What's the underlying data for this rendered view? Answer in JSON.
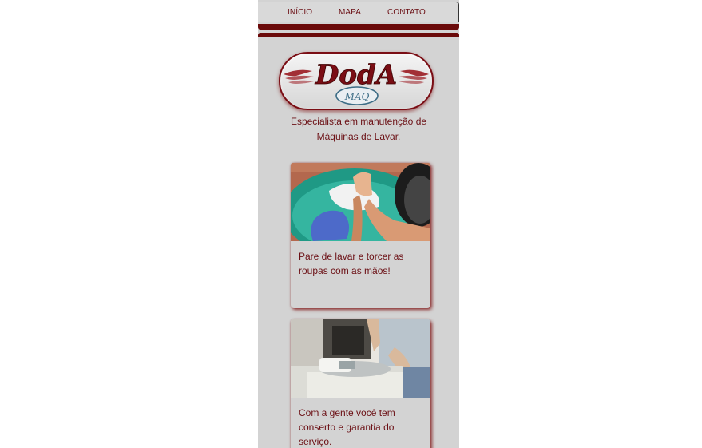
{
  "nav": {
    "items": [
      {
        "label": "INÍCIO"
      },
      {
        "label": "MAPA"
      },
      {
        "label": "CONTATO"
      }
    ]
  },
  "logo": {
    "brand": "DodA",
    "sub": "MAQ"
  },
  "tagline": "Especialista em manutenção de Máquinas de Lavar.",
  "cards": [
    {
      "text": "Pare de lavar e torcer as roupas com as mãos!",
      "image": "hand-washing-photo"
    },
    {
      "text": "Com a gente você tem conserto e garantia do serviço.",
      "image": "washing-machine-repair-photo"
    }
  ],
  "colors": {
    "accent": "#6b0f14",
    "bar": "#6a0a0a",
    "background": "#d3d3d3"
  }
}
